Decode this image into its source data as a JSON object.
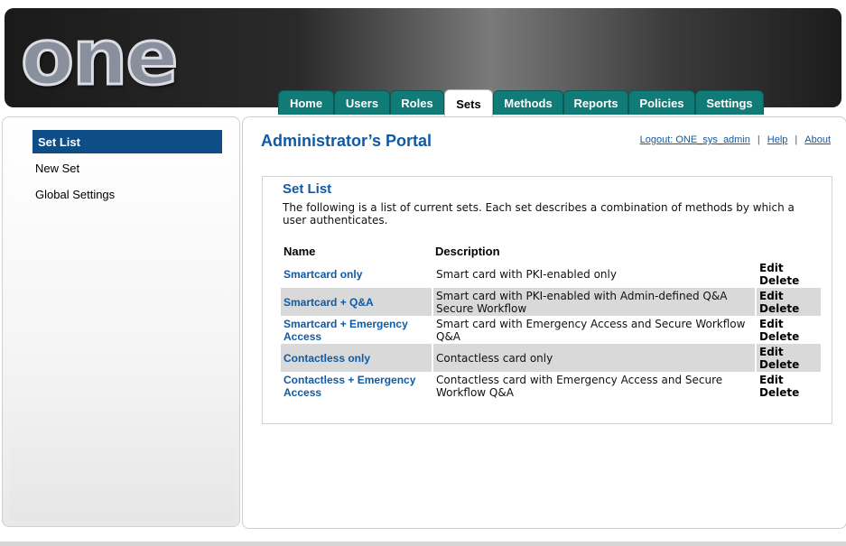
{
  "logo": "one",
  "tabs": [
    {
      "label": "Home",
      "active": false
    },
    {
      "label": "Users",
      "active": false
    },
    {
      "label": "Roles",
      "active": false
    },
    {
      "label": "Sets",
      "active": true
    },
    {
      "label": "Methods",
      "active": false
    },
    {
      "label": "Reports",
      "active": false
    },
    {
      "label": "Policies",
      "active": false
    },
    {
      "label": "Settings",
      "active": false
    }
  ],
  "sidebar": {
    "items": [
      {
        "label": "Set List",
        "active": true
      },
      {
        "label": "New Set",
        "active": false
      },
      {
        "label": "Global Settings",
        "active": false
      }
    ]
  },
  "header": {
    "portal_title": "Administrator’s Portal",
    "logout": "Logout: ONE_sys_admin",
    "help": "Help",
    "about": "About"
  },
  "main": {
    "title": "Set List",
    "description": "The following is a list of current sets. Each set describes a combination of methods by which a user authenticates.",
    "columns": {
      "name": "Name",
      "description": "Description"
    },
    "rows": [
      {
        "name": "Smartcard only",
        "description": "Smart card with PKI-enabled only",
        "edit": "Edit",
        "delete": "Delete"
      },
      {
        "name": "Smartcard + Q&A",
        "description": "Smart card with PKI-enabled with Admin-defined Q&A Secure Workflow",
        "edit": "Edit",
        "delete": "Delete"
      },
      {
        "name": "Smartcard + Emergency Access",
        "description": "Smart card with Emergency Access and Secure Workflow Q&A",
        "edit": "Edit",
        "delete": "Delete"
      },
      {
        "name": "Contactless only",
        "description": "Contactless card only",
        "edit": "Edit",
        "delete": "Delete"
      },
      {
        "name": "Contactless + Emergency Access",
        "description": "Contactless card with Emergency Access and Secure Workflow Q&A",
        "edit": "Edit",
        "delete": "Delete"
      }
    ]
  },
  "colors": {
    "tab": "#117b77",
    "link": "#0f5aa6",
    "selected": "#0f4d86",
    "row_shade": "#d9d9d9"
  }
}
